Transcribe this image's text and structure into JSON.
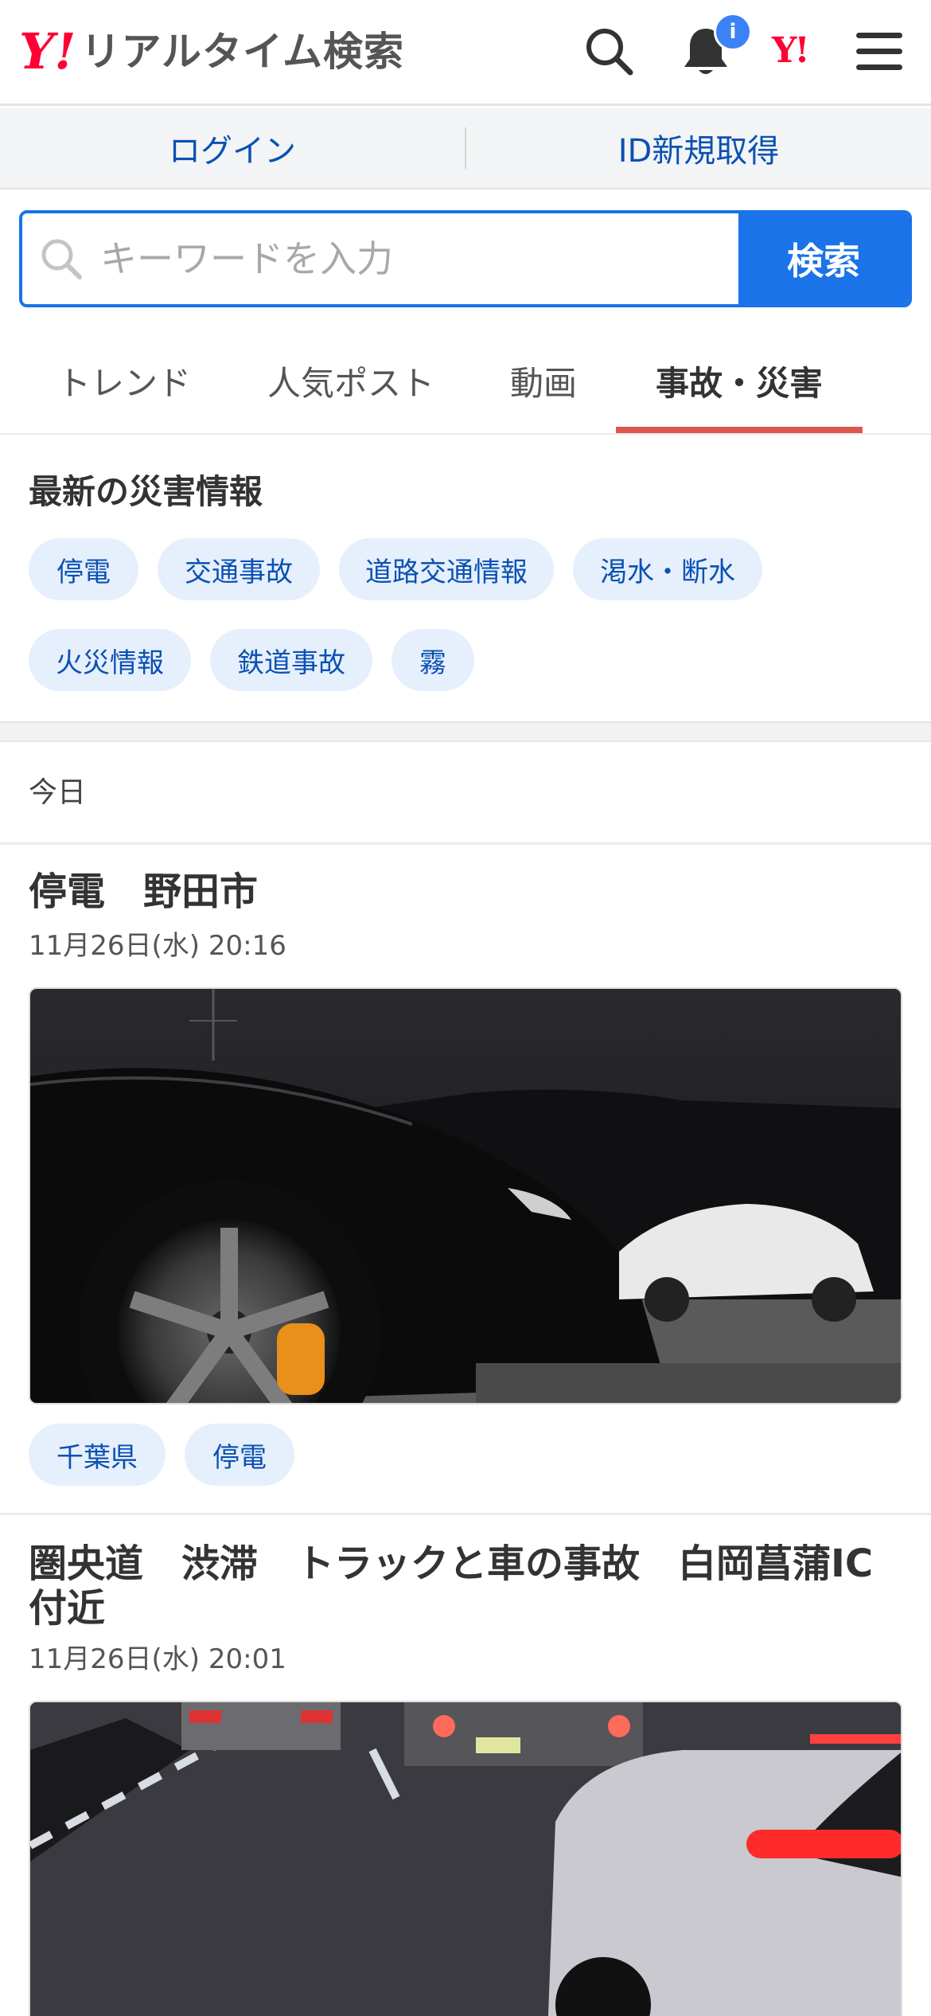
{
  "header": {
    "logo_mark": "Y!",
    "logo_text": "リアルタイム検索",
    "badge": "i",
    "yahoo_mini": "Y!",
    "icons": [
      "search-icon",
      "bell-icon",
      "yahoo-logo-icon",
      "menu-icon"
    ]
  },
  "auth": {
    "login": "ログイン",
    "register": "ID新規取得"
  },
  "search": {
    "placeholder": "キーワードを入力",
    "button": "検索"
  },
  "tabs": [
    {
      "label": "トレンド"
    },
    {
      "label": "人気ポスト"
    },
    {
      "label": "動画"
    },
    {
      "label": "事故・災害",
      "active": true
    }
  ],
  "disaster": {
    "title": "最新の災害情報",
    "chips": [
      "停電",
      "交通事故",
      "道路交通情報",
      "渇水・断水",
      "火災情報",
      "鉄道事故",
      "霧"
    ]
  },
  "feed": {
    "day_label": "今日",
    "posts": [
      {
        "title": "停電　野田市",
        "date": "11月26日(水) 20:16",
        "tags": [
          "千葉県",
          "停電"
        ]
      },
      {
        "title": "圏央道　渋滞　トラックと車の事故　白岡菖蒲IC付近",
        "date": "11月26日(水) 20:01",
        "tags": []
      }
    ]
  },
  "colors": {
    "brand_red": "#ff0033",
    "link_blue": "#0a51b3",
    "button_blue": "#1a73e8",
    "tab_underline": "#e0564f",
    "chip_bg": "#e6effc"
  }
}
